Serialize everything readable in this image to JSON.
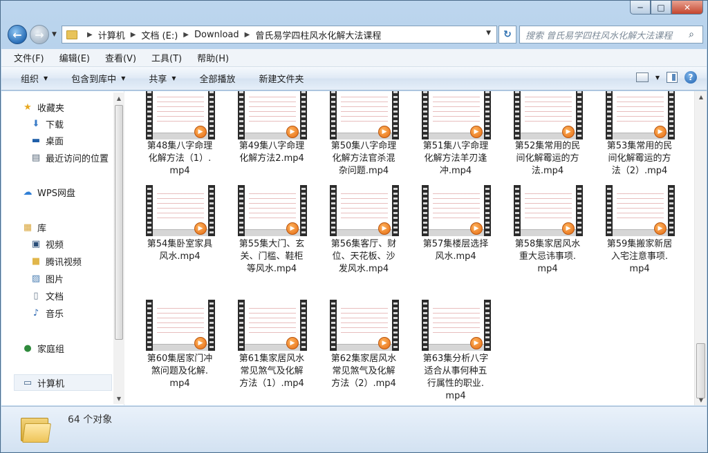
{
  "window": {
    "minimize": "─",
    "maximize": "□",
    "close": "✕"
  },
  "address": {
    "crumbs": [
      "计算机",
      "文档 (E:)",
      "Download",
      "曾氏易学四柱风水化解大法课程"
    ]
  },
  "search": {
    "placeholder": "搜索 曾氏易学四柱风水化解大法课程"
  },
  "menu": [
    "文件(F)",
    "编辑(E)",
    "查看(V)",
    "工具(T)",
    "帮助(H)"
  ],
  "toolbar": {
    "organize": "组织",
    "include": "包含到库中",
    "share": "共享",
    "play_all": "全部播放",
    "new_folder": "新建文件夹"
  },
  "nav": {
    "favorites": "收藏夹",
    "downloads": "下载",
    "desktop": "桌面",
    "recent": "最近访问的位置",
    "wps": "WPS网盘",
    "libraries": "库",
    "videos": "视频",
    "tencent_video": "腾讯视频",
    "pictures": "图片",
    "documents": "文档",
    "music": "音乐",
    "homegroup": "家庭组",
    "computer": "计算机"
  },
  "files": [
    {
      "lines": [
        "第48集八字命理",
        "化解方法（1）.",
        "mp4"
      ]
    },
    {
      "lines": [
        "第49集八字命理",
        "化解方法2.mp4"
      ]
    },
    {
      "lines": [
        "第50集八字命理",
        "化解方法官杀混",
        "杂问题.mp4"
      ]
    },
    {
      "lines": [
        "第51集八字命理",
        "化解方法羊刃逢",
        "冲.mp4"
      ]
    },
    {
      "lines": [
        "第52集常用的民",
        "间化解霉运的方",
        "法.mp4"
      ]
    },
    {
      "lines": [
        "第53集常用的民",
        "间化解霉运的方",
        "法（2）.mp4"
      ]
    },
    {
      "lines": [
        "第54集卧室家具",
        "风水.mp4"
      ]
    },
    {
      "lines": [
        "第55集大门、玄",
        "关、门槛、鞋柜",
        "等风水.mp4"
      ]
    },
    {
      "lines": [
        "第56集客厅、财",
        "位、天花板、沙",
        "发风水.mp4"
      ]
    },
    {
      "lines": [
        "第57集楼层选择",
        "风水.mp4"
      ]
    },
    {
      "lines": [
        "第58集家居风水",
        "重大忌讳事项.",
        "mp4"
      ]
    },
    {
      "lines": [
        "第59集搬家新居",
        "入宅注意事项.",
        "mp4"
      ]
    },
    {
      "lines": [
        "第60集居家门冲",
        "煞问题及化解.",
        "mp4"
      ]
    },
    {
      "lines": [
        "第61集家居风水",
        "常见煞气及化解",
        "方法（1）.mp4"
      ]
    },
    {
      "lines": [
        "第62集家居风水",
        "常见煞气及化解",
        "方法（2）.mp4"
      ]
    },
    {
      "lines": [
        "第63集分析八字",
        "适合从事何种五",
        "行属性的职业.",
        "mp4"
      ]
    }
  ],
  "status": {
    "count": "64 个对象"
  }
}
